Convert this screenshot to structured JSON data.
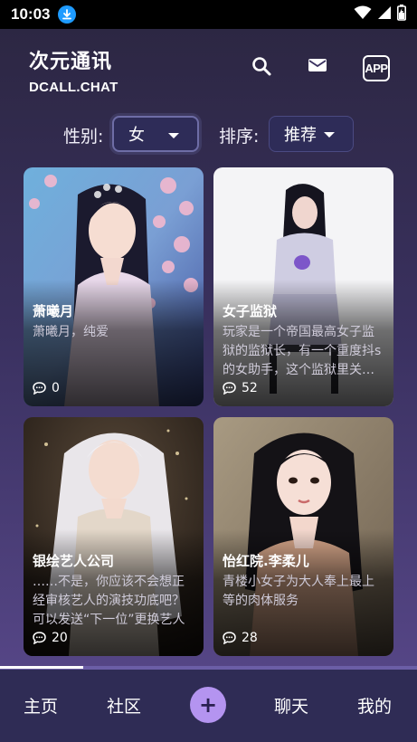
{
  "status_bar": {
    "time": "10:03"
  },
  "header": {
    "title": "次元通讯",
    "subtitle": "DCALL.CHAT",
    "app_badge": "APP"
  },
  "filters": {
    "gender_label": "性别:",
    "gender_value": "女",
    "sort_label": "排序:",
    "sort_value": "推荐"
  },
  "cards": [
    {
      "title": "萧曦月",
      "desc": "萧曦月，纯爱",
      "count": "0"
    },
    {
      "title": "女子监狱",
      "desc": "玩家是一个帝国最高女子监狱的监狱长，有一个重度抖s的女助手，这个监狱里关押着",
      "count": "52"
    },
    {
      "title": "银绘艺人公司",
      "desc": "……不是，你应该不会想正经审核艺人的演技功底吧？ 可以发送“下一位”更换艺人",
      "count": "20"
    },
    {
      "title": "怡红院.李柔儿",
      "desc": "青楼小女子为大人奉上最上等的肉体服务",
      "count": "28"
    }
  ],
  "nav": {
    "home": "主页",
    "community": "社区",
    "plus": "+",
    "chat": "聊天",
    "mine": "我的"
  },
  "colors": {
    "accent": "#b494f0",
    "nav_bg": "#2f2c55",
    "select_bg": "#2e2c58"
  },
  "icons": [
    "download-icon",
    "wifi-icon",
    "signal-icon",
    "battery-icon",
    "search-icon",
    "mail-icon",
    "app-icon",
    "comment-icon"
  ]
}
